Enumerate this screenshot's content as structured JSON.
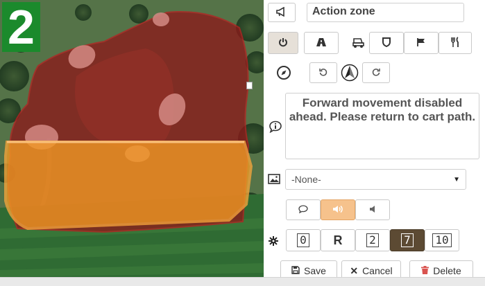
{
  "badge": {
    "step": "2"
  },
  "zone": {
    "name": "Action zone"
  },
  "message": {
    "text": "Forward movement disabled ahead. Please return to cart path."
  },
  "image_select": {
    "value": "-None-"
  },
  "speed_options": [
    "0",
    "R",
    "2",
    "7",
    "10"
  ],
  "speed_selected": "7",
  "actions": {
    "save": "Save",
    "cancel": "Cancel",
    "delete": "Delete"
  },
  "icons": {
    "zone_name": "megaphone-icon",
    "power": "power-icon",
    "road": "road-icon",
    "cart": "golf-cart-icon",
    "shield": "shield-icon",
    "flag": "flag-icon",
    "dining": "fork-knife-icon",
    "compass": "compass-icon",
    "rotate_left": "rotate-left-icon",
    "north_arrow": "north-arrow-icon",
    "rotate_right": "rotate-right-icon",
    "info": "info-icon",
    "image": "image-icon",
    "speech": "speech-bubble-icon",
    "sound": "speaker-loud-icon",
    "mute": "speaker-low-icon",
    "settings": "gear-icon",
    "save": "floppy-disk-icon",
    "cancel": "close-icon",
    "delete": "trash-icon"
  },
  "colors": {
    "pressed": "#e6e0d8",
    "selected_speed": "#5c4a33",
    "sound_active": "#f6c28c",
    "badge": "#1b8a2c",
    "danger": "#d9534f",
    "red_zone": "#8b1a1a",
    "orange_zone": "#f39a24"
  }
}
